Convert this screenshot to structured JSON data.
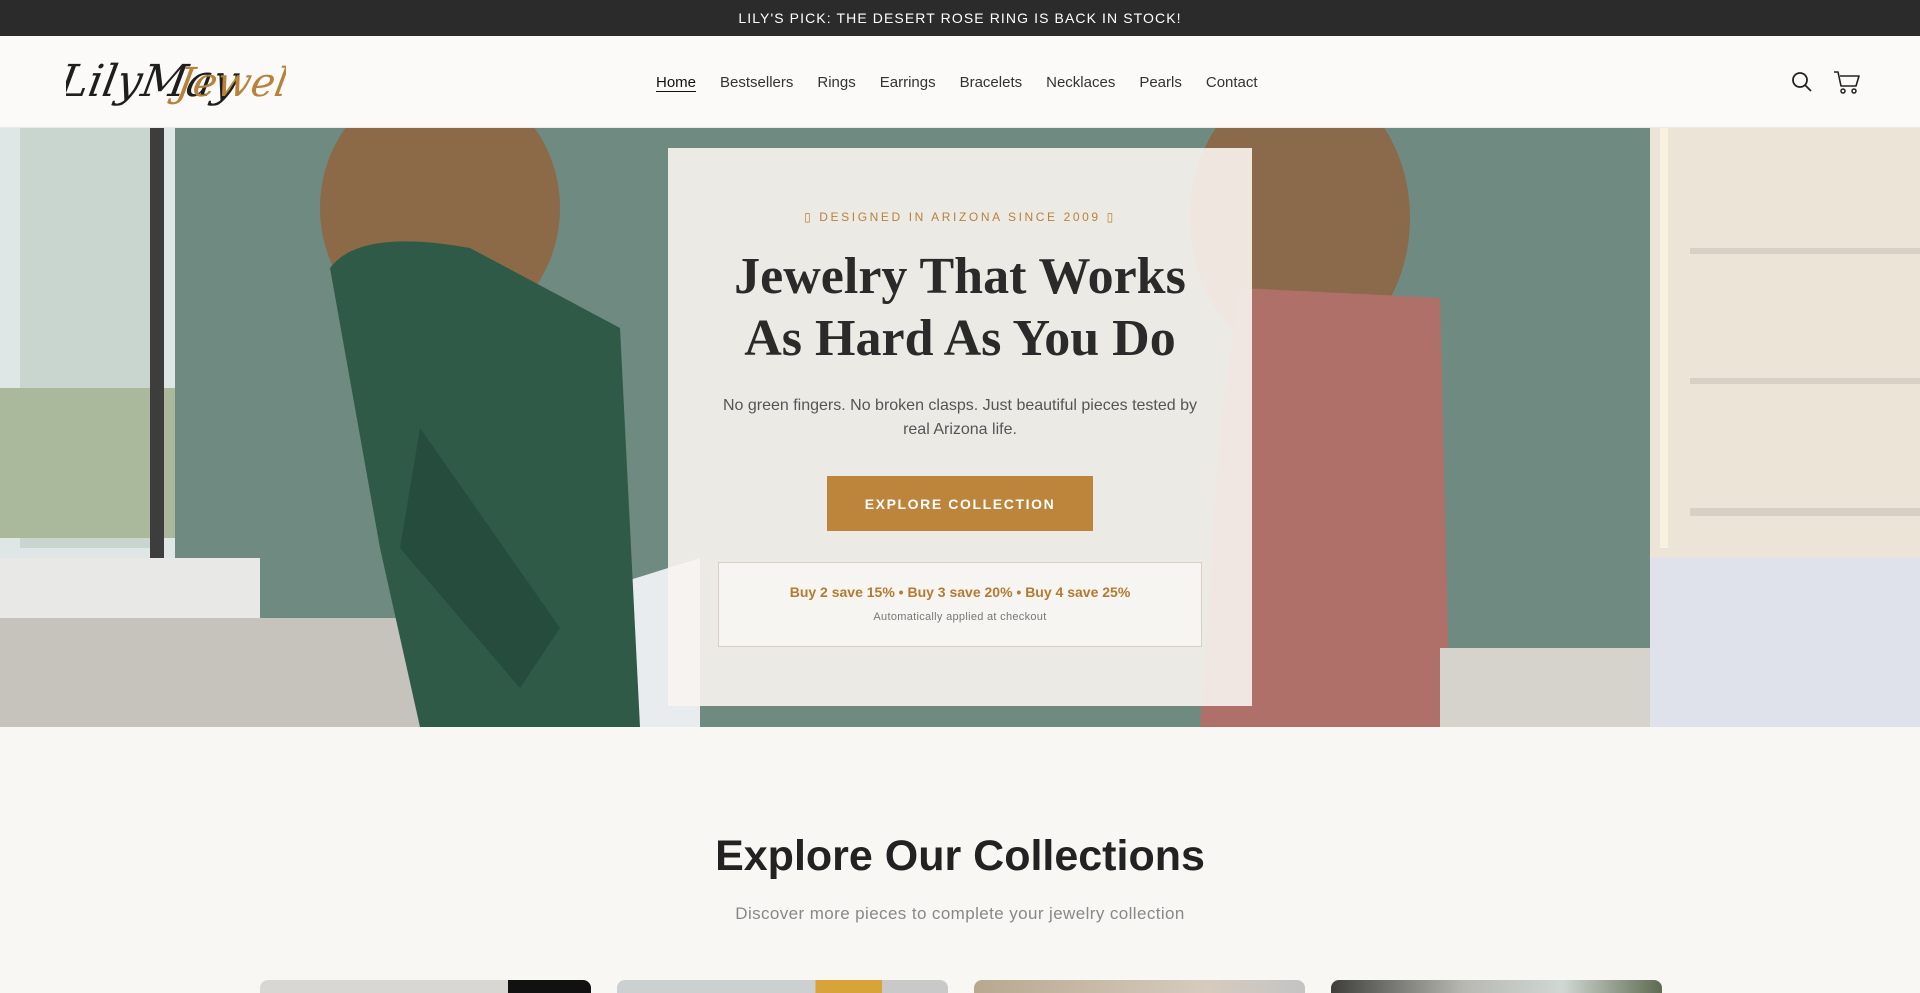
{
  "announcement": "LILY'S PICK: THE DESERT ROSE RING IS BACK IN STOCK!",
  "brand": {
    "logo_text_dark": "LilyMay",
    "logo_text_gold": "Jewelry",
    "accent": "#bc853b",
    "dark": "#2b2b2b"
  },
  "nav": {
    "items": [
      {
        "label": "Home",
        "active": true
      },
      {
        "label": "Bestsellers"
      },
      {
        "label": "Rings"
      },
      {
        "label": "Earrings"
      },
      {
        "label": "Bracelets"
      },
      {
        "label": "Necklaces"
      },
      {
        "label": "Pearls"
      },
      {
        "label": "Contact"
      }
    ]
  },
  "header_icons": [
    "search-icon",
    "cart-icon"
  ],
  "hero": {
    "eyebrow": "▯ DESIGNED IN ARIZONA SINCE 2009 ▯",
    "title_line1": "Jewelry That Works",
    "title_line2": "As Hard As You Do",
    "subtitle": "No green fingers. No broken clasps. Just beautiful pieces tested by real Arizona life.",
    "cta": "EXPLORE COLLECTION",
    "offer": "Buy 2 save 15% • Buy 3 save 20% • Buy 4 save 25%",
    "offer_note": "Automatically applied at checkout"
  },
  "collections": {
    "title": "Explore Our Collections",
    "subtitle": "Discover more pieces to complete your jewelry collection"
  }
}
